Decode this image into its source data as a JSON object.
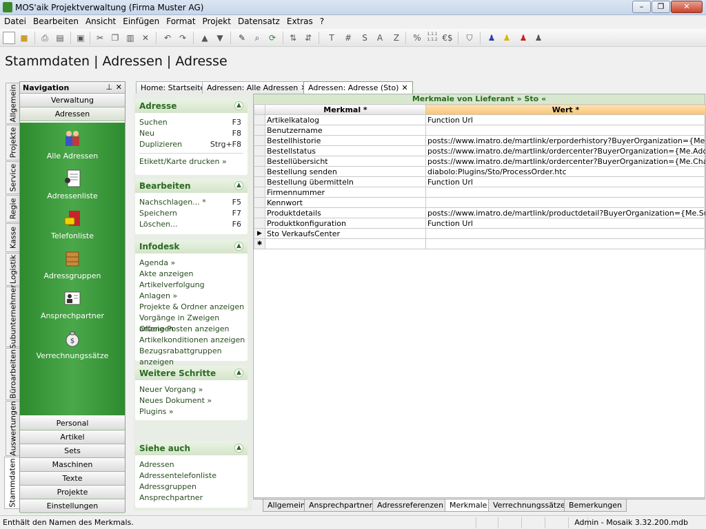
{
  "window": {
    "title": "MOS'aik Projektverwaltung (Firma Muster AG)",
    "minimize": "–",
    "restore": "❐",
    "close": "✕"
  },
  "menu": [
    "Datei",
    "Bearbeiten",
    "Ansicht",
    "Einfügen",
    "Format",
    "Projekt",
    "Datensatz",
    "Extras",
    "?"
  ],
  "toolbar": {
    "text_buttons": [
      "T",
      "#",
      "S",
      "A",
      "Z",
      "%",
      "1.1.1\n1.1.2",
      "€$"
    ]
  },
  "page_title": "Stammdaten | Adressen | Adresse",
  "vertical_tabs": [
    "Allgemein",
    "Projekte",
    "Service",
    "Regie",
    "Kasse",
    "Logistik",
    "Subunternehmer",
    "Büroarbeiten",
    "Auswertungen",
    "Stammdaten"
  ],
  "navigation": {
    "title": "Navigation",
    "pin": "⊥",
    "close": "✕",
    "top_buttons": [
      "Verwaltung",
      "Adressen"
    ],
    "items": [
      {
        "label": "Alle Adressen",
        "icon": "people-icon"
      },
      {
        "label": "Adressenliste",
        "icon": "address-list-icon"
      },
      {
        "label": "Telefonliste",
        "icon": "phone-book-icon"
      },
      {
        "label": "Adressgruppen",
        "icon": "address-groups-icon"
      },
      {
        "label": "Ansprechpartner",
        "icon": "contact-person-icon"
      },
      {
        "label": "Verrechnungssätze",
        "icon": "money-bag-icon"
      }
    ],
    "bottom_buttons": [
      "Personal",
      "Artikel",
      "Sets",
      "Maschinen",
      "Texte",
      "Projekte",
      "Einstellungen"
    ]
  },
  "doc_tabs": [
    {
      "label": "Home: Startseite"
    },
    {
      "label": "Adressen: Alle Adressen",
      "close": "✕"
    },
    {
      "label": "Adressen: Adresse (Sto)",
      "close": "✕",
      "active": true
    }
  ],
  "taskpane": {
    "adresse": {
      "title": "Adresse",
      "toggle": "▲",
      "items": [
        {
          "label": "Suchen",
          "key": "F3"
        },
        {
          "label": "Neu",
          "key": "F8"
        },
        {
          "label": "Duplizieren",
          "key": "Strg+F8"
        }
      ],
      "extra": "Etikett/Karte drucken »"
    },
    "bearbeiten": {
      "title": "Bearbeiten",
      "toggle": "▲",
      "items": [
        {
          "label": "Nachschlagen... *",
          "key": "F5"
        },
        {
          "label": "Speichern",
          "key": "F7"
        },
        {
          "label": "Löschen...",
          "key": "F6"
        }
      ]
    },
    "infodesk": {
      "title": "Infodesk",
      "toggle": "▲",
      "items": [
        "Agenda »",
        "Akte anzeigen",
        "Artikelverfolgung",
        "Anlagen »",
        "Projekte & Ordner anzeigen",
        "Vorgänge in Zweigen anzeigen",
        "Offene Posten anzeigen",
        "Artikelkonditionen anzeigen",
        "Bezugsrabattgruppen anzeigen"
      ]
    },
    "weitere": {
      "title": "Weitere Schritte",
      "toggle": "▲",
      "items": [
        "Neuer Vorgang »",
        "Neues Dokument »",
        "Plugins »"
      ]
    },
    "siehe": {
      "title": "Siehe auch",
      "toggle": "▲",
      "items": [
        "Adressen",
        "Adressentelefonliste",
        "Adressgruppen",
        "Ansprechpartner"
      ]
    }
  },
  "grid": {
    "title": "Merkmale von Lieferant » Sto «",
    "columns": [
      "Merkmal *",
      "Wert *"
    ],
    "current_marker": "▶",
    "new_marker": "✱",
    "rows": [
      {
        "merkmal": "Artikelkatalog",
        "wert": "Function Url"
      },
      {
        "merkmal": "Benutzername",
        "wert": ""
      },
      {
        "merkmal": "Bestellhistorie",
        "wert": "posts://www.imatro.de/martlink/erporderhistory?BuyerOrganization={Me.Charac"
      },
      {
        "merkmal": "Bestellstatus",
        "wert": "posts://www.imatro.de/martlink/ordercenter?BuyerOrganization={Me.Address.C"
      },
      {
        "merkmal": "Bestellübersicht",
        "wert": "posts://www.imatro.de/martlink/ordercenter?BuyerOrganization={Me.Characteri"
      },
      {
        "merkmal": "Bestellung senden",
        "wert": "diabolo:Plugins/Sto/ProcessOrder.htc"
      },
      {
        "merkmal": "Bestellung übermitteln",
        "wert": "Function Url"
      },
      {
        "merkmal": "Firmennummer",
        "wert": ""
      },
      {
        "merkmal": "Kennwort",
        "wert": ""
      },
      {
        "merkmal": "Produktdetails",
        "wert": "posts://www.imatro.de/martlink/productdetail?BuyerOrganization={Me.Supplier."
      },
      {
        "merkmal": "Produktkonfiguration",
        "wert": "Function Url"
      },
      {
        "merkmal": "Sto VerkaufsCenter",
        "wert": ""
      }
    ]
  },
  "bottom_tabs": [
    {
      "label": "Allgemein"
    },
    {
      "label": "Ansprechpartner"
    },
    {
      "label": "Adressreferenzen"
    },
    {
      "label": "Merkmale",
      "active": true
    },
    {
      "label": "Verrechnungssätze"
    },
    {
      "label": "Bemerkungen"
    }
  ],
  "status": {
    "left": "Enthält den Namen des Merkmals.",
    "right": "Admin - Mosaik 3.32.200.mdb"
  }
}
